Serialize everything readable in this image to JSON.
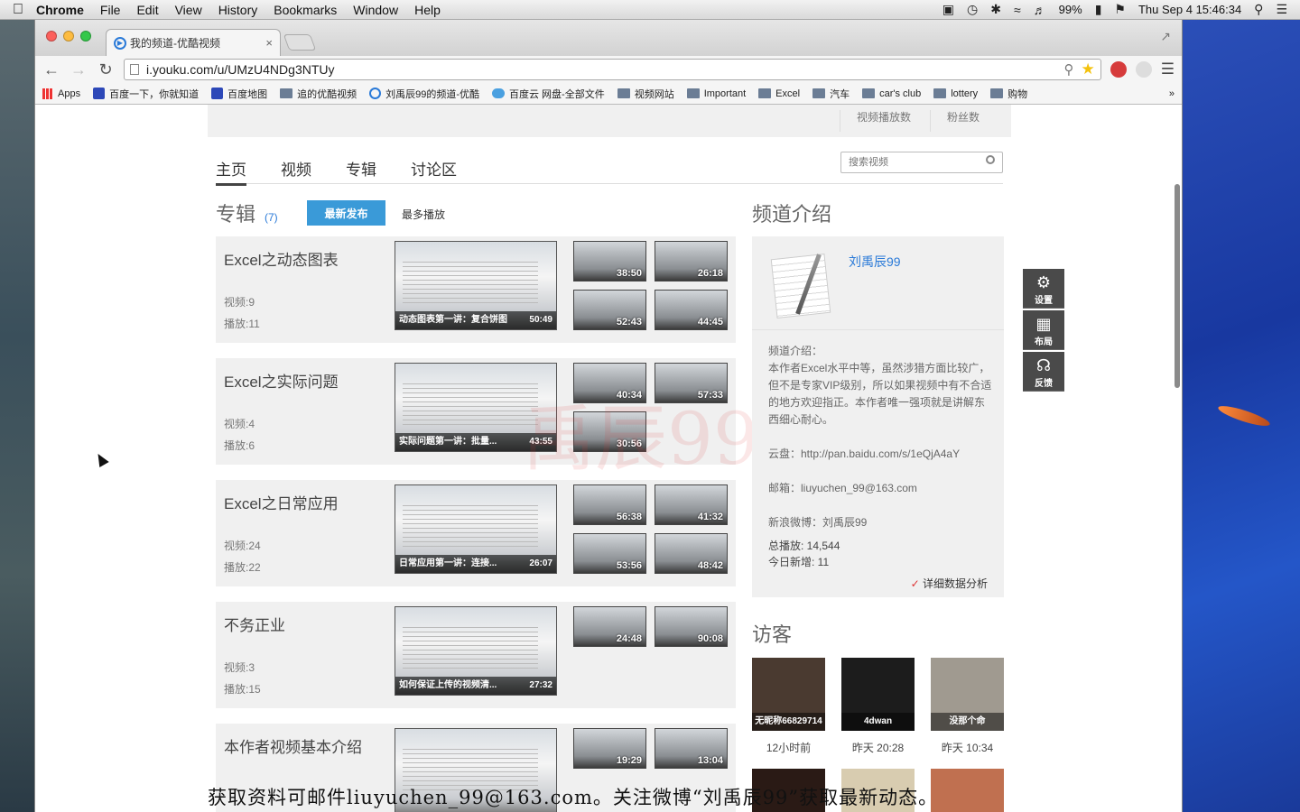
{
  "menubar": {
    "app": "Chrome",
    "items": [
      "File",
      "Edit",
      "View",
      "History",
      "Bookmarks",
      "Window",
      "Help"
    ],
    "battery": "99%",
    "clock": "Thu Sep 4  15:46:34"
  },
  "browser": {
    "tab_title": "我的频道-优酷视频",
    "url": "i.youku.com/u/UMzU4NDg3NTUy",
    "bookmarks": [
      "Apps",
      "百度一下，你就知道",
      "百度地图",
      "追的优酷视频",
      "刘禹辰99的频道-优酷",
      "百度云 网盘-全部文件",
      "视频网站",
      "Important",
      "Excel",
      "汽车",
      "car's club",
      "lottery",
      "购物"
    ],
    "bookmarks_more": "»"
  },
  "stats_strip": {
    "play_count_label": "视频播放数",
    "fans_label": "粉丝数"
  },
  "nav": {
    "tabs": [
      "主页",
      "视频",
      "专辑",
      "讨论区"
    ],
    "search_placeholder": "搜索视频"
  },
  "albums": {
    "title": "专辑",
    "count": "(7)",
    "sort_new": "最新发布",
    "sort_most": "最多播放",
    "items": [
      {
        "name": "Excel之动态图表",
        "videos": "视频:9",
        "plays": "播放:11",
        "main_caption": "动态图表第一讲：复合饼图",
        "main_duration": "50:49",
        "small_durations": [
          "38:50",
          "26:18",
          "52:43",
          "44:45"
        ]
      },
      {
        "name": "Excel之实际问题",
        "videos": "视频:4",
        "plays": "播放:6",
        "main_caption": "实际问题第一讲：批量...",
        "main_duration": "43:55",
        "small_durations": [
          "40:34",
          "57:33",
          "30:56"
        ]
      },
      {
        "name": "Excel之日常应用",
        "videos": "视频:24",
        "plays": "播放:22",
        "main_caption": "日常应用第一讲：连接...",
        "main_duration": "26:07",
        "small_durations": [
          "56:38",
          "41:32",
          "53:56",
          "48:42"
        ]
      },
      {
        "name": "不务正业",
        "videos": "视频:3",
        "plays": "播放:15",
        "main_caption": "如何保证上传的视频清...",
        "main_duration": "27:32",
        "small_durations": [
          "24:48",
          "90:08"
        ]
      },
      {
        "name": "本作者视频基本介绍",
        "videos": "",
        "plays": "",
        "main_caption": "",
        "main_duration": "",
        "small_durations": [
          "19:29",
          "13:04"
        ]
      }
    ]
  },
  "channel_intro": {
    "title": "频道介绍",
    "username": "刘禹辰99",
    "intro_label": "频道介绍：",
    "intro_text": "本作者Excel水平中等，虽然涉猎方面比较广，但不是专家VIP级别，所以如果视频中有不合适的地方欢迎指正。本作者唯一强项就是讲解东西细心耐心。",
    "cloud": "云盘：http://pan.baidu.com/s/1eQjA4aY",
    "email": "邮箱：liuyuchen_99@163.com",
    "weibo": "新浪微博：刘禹辰99",
    "total_plays": "总播放: 14,544",
    "today_new": "今日新增: 11",
    "detail_link": "详细数据分析"
  },
  "visitors": {
    "title": "访客",
    "items": [
      {
        "label": "无昵称66829714",
        "time": "12小时前",
        "color": "#4a3a30"
      },
      {
        "label": "4dwan",
        "time": "昨天 20:28",
        "color": "#1c1c1c"
      },
      {
        "label": "没那个命",
        "time": "昨天 10:34",
        "color": "#a09a90"
      }
    ]
  },
  "side_tools": [
    {
      "label": "设置",
      "icon": "gear-icon"
    },
    {
      "label": "布局",
      "icon": "layout-icon"
    },
    {
      "label": "反馈",
      "icon": "headset-icon"
    }
  ],
  "overlay_text": "获取资料可邮件liuyuchen_99@163.com。关注微博“刘禹辰99”获取最新动态。",
  "watermark": "禹辰99"
}
